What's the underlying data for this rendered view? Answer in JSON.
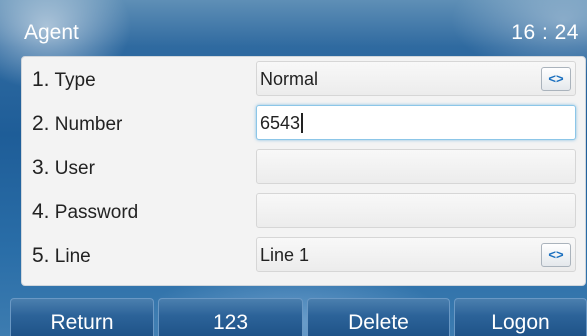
{
  "header": {
    "title": "Agent",
    "clock": "16 : 24"
  },
  "form": {
    "rows": [
      {
        "num": "1.",
        "label": "Type",
        "value": "Normal",
        "has_switch": true
      },
      {
        "num": "2.",
        "label": "Number",
        "value": "6543",
        "active": true
      },
      {
        "num": "3.",
        "label": "User",
        "value": ""
      },
      {
        "num": "4.",
        "label": "Password",
        "value": ""
      },
      {
        "num": "5.",
        "label": "Line",
        "value": "Line 1",
        "has_switch": true
      }
    ],
    "switch_glyph": "<>",
    "switch_icon": "left-right-arrows-icon"
  },
  "softkeys": {
    "return": "Return",
    "input_mode": "123",
    "delete": "Delete",
    "logon": "Logon"
  },
  "colors": {
    "background": "#1e5d98",
    "panel": "#f3f3f3",
    "active_field_border": "#8cc6e8",
    "switch_glyph": "#1a6fbf",
    "softkey": "#2c6399"
  }
}
